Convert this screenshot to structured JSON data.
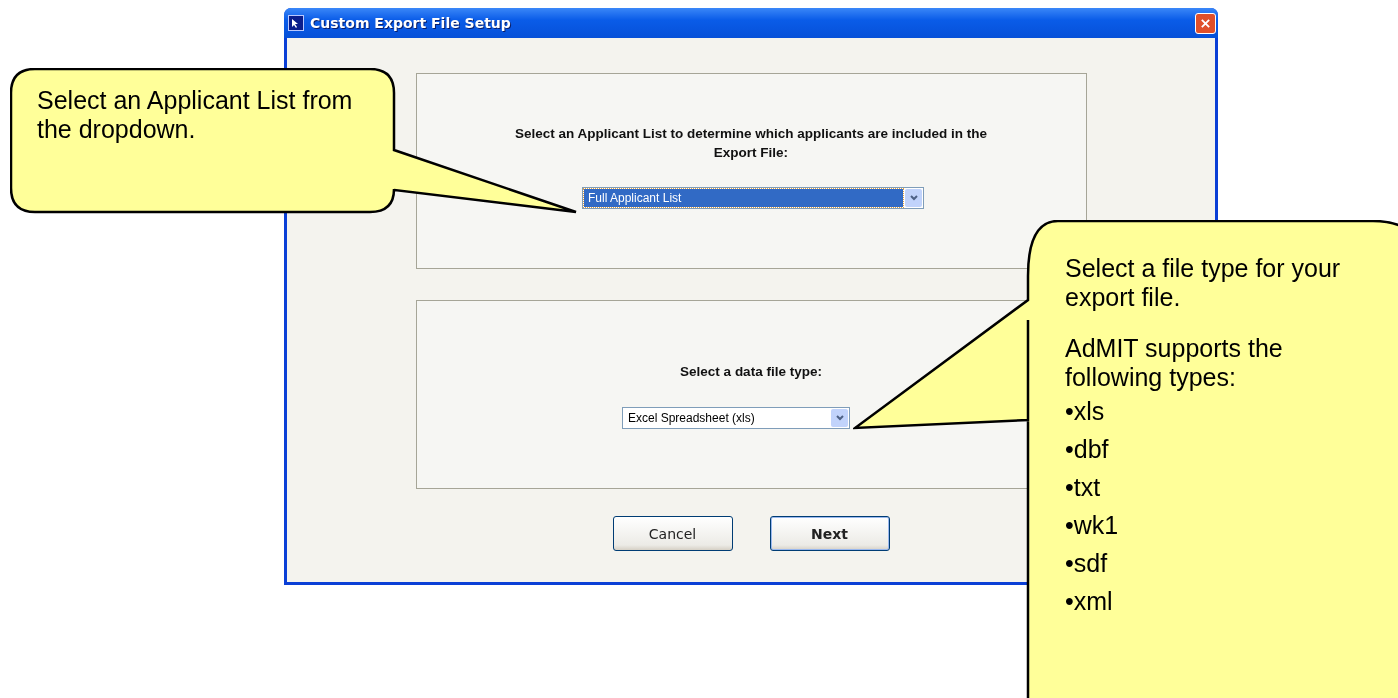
{
  "window": {
    "title": "Custom Export File Setup"
  },
  "list_group": {
    "prompt": "Select an Applicant List to determine which applicants are included in the Export File:",
    "dropdown": {
      "value": "Full Applicant List",
      "focused": true
    }
  },
  "type_group": {
    "prompt": "Select a data file type:",
    "dropdown": {
      "value": "Excel Spreadsheet (xls)",
      "focused": false
    }
  },
  "buttons": [
    {
      "label": "Cancel",
      "default": false
    },
    {
      "label": "Next",
      "default": true
    }
  ],
  "callouts": [
    {
      "paragraphs": [
        "Select an Applicant List from the dropdown."
      ]
    },
    {
      "paragraphs": [
        "Select a file type for your export file.",
        "AdMIT  supports the following types:"
      ],
      "bullets": [
        "xls",
        "dbf",
        "txt",
        "wk1",
        "sdf",
        "xml"
      ]
    }
  ],
  "bullet_mark": "•"
}
